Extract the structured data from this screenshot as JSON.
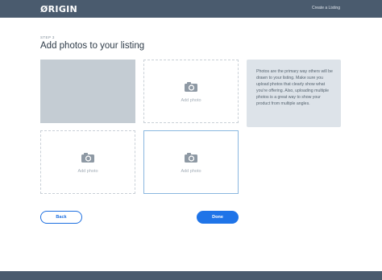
{
  "header": {
    "logo": "ØRIGIN",
    "link": "Create a Listing"
  },
  "page": {
    "step": "STEP 3",
    "title": "Add photos to your listing"
  },
  "photos": {
    "add_label": "Add photo",
    "slots": [
      {
        "state": "filled"
      },
      {
        "state": "empty",
        "label": "Add photo"
      },
      {
        "state": "empty",
        "label": "Add photo"
      },
      {
        "state": "selected",
        "label": "Add photo"
      }
    ]
  },
  "tip": {
    "text": "Photos are the primary way others will be drawn to your listing. Make sure you upload photos that clearly show what you're offering. Also, uploading multiple photos is a great way to show your product from multiple angles."
  },
  "buttons": {
    "back": "Back",
    "done": "Done"
  },
  "colors": {
    "topbar": "#4a5b6e",
    "accent": "#1f74e8",
    "filled_slot": "#c4ccd3",
    "tip_bg": "#dde3e9"
  },
  "icons": {
    "camera": "camera-icon"
  }
}
